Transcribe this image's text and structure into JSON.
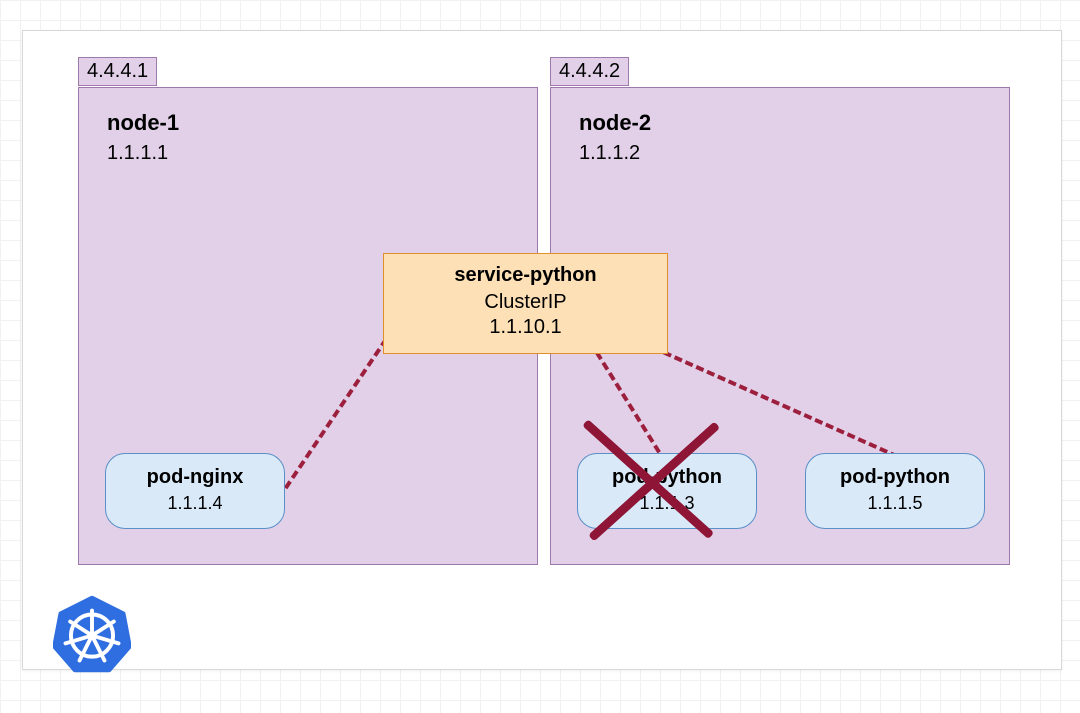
{
  "nodes": [
    {
      "tag_ip": "4.4.4.1",
      "name": "node-1",
      "ip": "1.1.1.1",
      "pods": [
        {
          "name": "pod-nginx",
          "ip": "1.1.1.4",
          "crossed": false
        }
      ]
    },
    {
      "tag_ip": "4.4.4.2",
      "name": "node-2",
      "ip": "1.1.1.2",
      "pods": [
        {
          "name": "pod-python",
          "ip": "1.1.1.3",
          "crossed": true
        },
        {
          "name": "pod-python",
          "ip": "1.1.1.5",
          "crossed": false
        }
      ]
    }
  ],
  "service": {
    "name": "service-python",
    "type": "ClusterIP",
    "ip": "1.1.10.1"
  },
  "logo": "kubernetes-icon"
}
